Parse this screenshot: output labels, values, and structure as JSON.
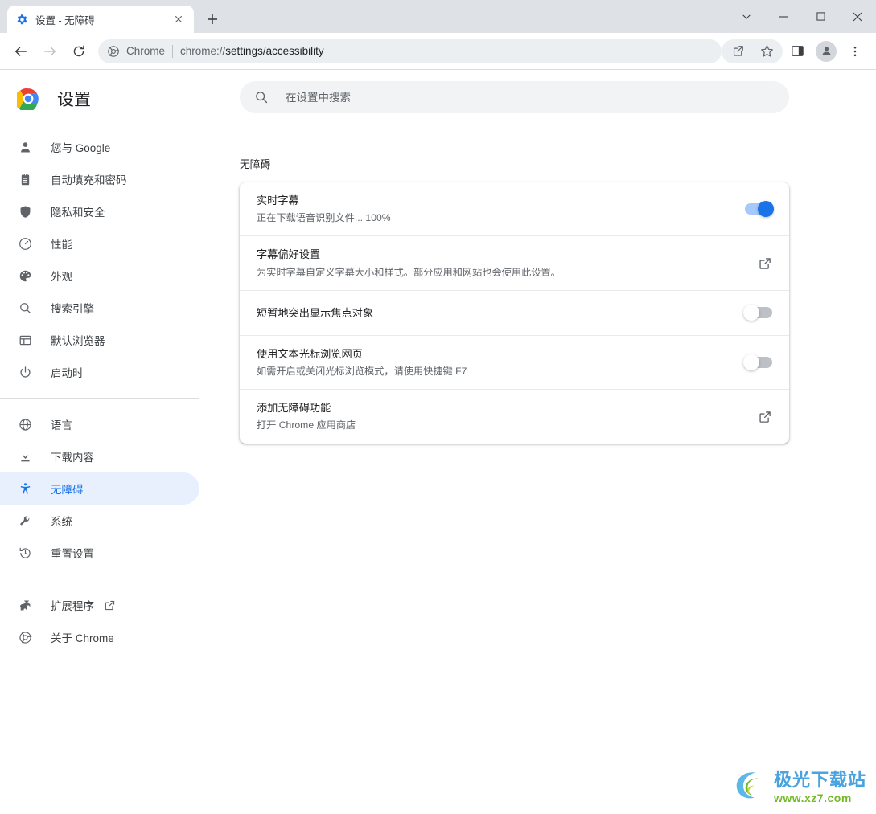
{
  "window": {
    "tab": {
      "title": "设置 - 无障碍",
      "favicon": "gear-icon",
      "close": "×",
      "new_tab": "+"
    },
    "controls": {
      "tab_search": "tab-search-chevron-icon",
      "minimize": "minimize-icon",
      "maximize": "maximize-icon",
      "close": "close-icon"
    }
  },
  "toolbar": {
    "back": "back-arrow-icon",
    "forward": "forward-arrow-icon",
    "reload": "reload-icon",
    "omnibox": {
      "chrome_label": "Chrome",
      "url_scheme": "chrome://",
      "url_path": "settings/accessibility",
      "full_url": "chrome://settings/accessibility"
    },
    "share": "share-icon",
    "bookmark": "star-icon",
    "side_panel": "side-panel-icon",
    "profile": "profile-avatar-icon",
    "menu": "three-dot-menu-icon"
  },
  "sidebar": {
    "header": {
      "logo": "chrome-logo-icon",
      "title": "设置"
    },
    "groups": [
      {
        "items": [
          {
            "label": "您与 Google",
            "icon": "person-icon"
          },
          {
            "label": "自动填充和密码",
            "icon": "clipboard-icon"
          },
          {
            "label": "隐私和安全",
            "icon": "shield-icon"
          },
          {
            "label": "性能",
            "icon": "speedometer-icon"
          },
          {
            "label": "外观",
            "icon": "palette-icon"
          },
          {
            "label": "搜索引擎",
            "icon": "search-icon"
          },
          {
            "label": "默认浏览器",
            "icon": "browser-window-icon"
          },
          {
            "label": "启动时",
            "icon": "power-icon"
          }
        ]
      },
      {
        "items": [
          {
            "label": "语言",
            "icon": "globe-icon"
          },
          {
            "label": "下载内容",
            "icon": "download-icon"
          },
          {
            "label": "无障碍",
            "icon": "accessibility-icon",
            "selected": true
          },
          {
            "label": "系统",
            "icon": "wrench-icon"
          },
          {
            "label": "重置设置",
            "icon": "history-restore-icon"
          }
        ]
      },
      {
        "items": [
          {
            "label": "扩展程序",
            "icon": "puzzle-icon",
            "external": true
          },
          {
            "label": "关于 Chrome",
            "icon": "chrome-outline-icon"
          }
        ]
      }
    ]
  },
  "search": {
    "placeholder": "在设置中搜索",
    "value": "",
    "icon": "search-icon"
  },
  "main": {
    "section_title": "无障碍",
    "rows": [
      {
        "title": "实时字幕",
        "subtitle": "正在下载语音识别文件... 100%",
        "control": "toggle",
        "state": "on",
        "focused": true
      },
      {
        "title": "字幕偏好设置",
        "subtitle": "为实时字幕自定义字幕大小和样式。部分应用和网站也会使用此设置。",
        "control": "external-link",
        "state": ""
      },
      {
        "title": "短暂地突出显示焦点对象",
        "subtitle": "",
        "control": "toggle",
        "state": "off"
      },
      {
        "title": "使用文本光标浏览网页",
        "subtitle": "如需开启或关闭光标浏览模式，请使用快捷键 F7",
        "control": "toggle",
        "state": "off"
      },
      {
        "title": "添加无障碍功能",
        "subtitle": "打开 Chrome 应用商店",
        "control": "external-link",
        "state": ""
      }
    ]
  },
  "watermark": {
    "main": "极光下载站",
    "sub": "www.xz7.com"
  },
  "colors": {
    "accent": "#1a73e8",
    "selected_bg": "#e8f0fe",
    "titlebar": "#dee1e6",
    "omnibox": "#eceff1",
    "toggle_off": "#bdc1c6"
  }
}
